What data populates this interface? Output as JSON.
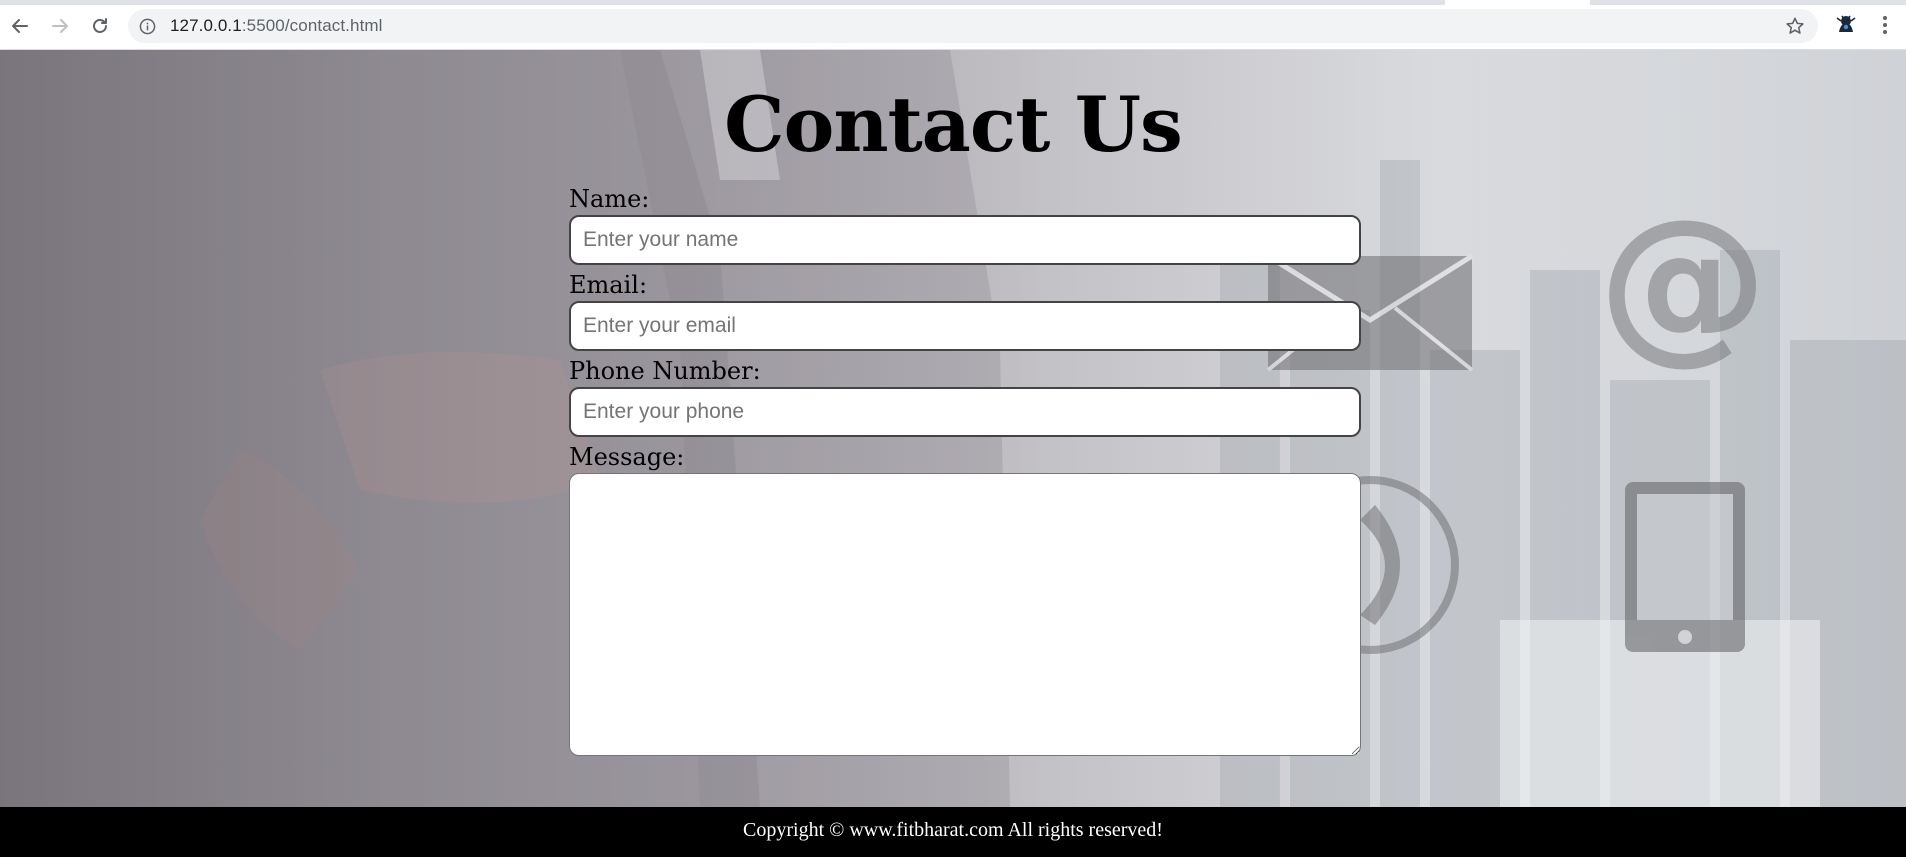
{
  "browser": {
    "url_host": "127.0.0.1",
    "url_path": ":5500/contact.html"
  },
  "page": {
    "title": "Contact Us"
  },
  "form": {
    "name_label": "Name:",
    "name_placeholder": "Enter your name",
    "email_label": "Email:",
    "email_placeholder": "Enter your email",
    "phone_label": "Phone Number:",
    "phone_placeholder": "Enter your phone",
    "message_label": "Message:",
    "message_value": ""
  },
  "footer": {
    "text": "Copyright © www.fitbharat.com All rights reserved!"
  },
  "icons": {
    "back": "arrow-left-icon",
    "forward": "arrow-right-icon",
    "reload": "reload-icon",
    "site_info": "info-icon",
    "bookmark": "star-icon",
    "extension": "extension-icon",
    "menu": "kebab-menu-icon"
  },
  "colors": {
    "footer_bg": "#000000",
    "footer_text": "#ffffff",
    "title": "#000000",
    "field_border": "#444444"
  }
}
